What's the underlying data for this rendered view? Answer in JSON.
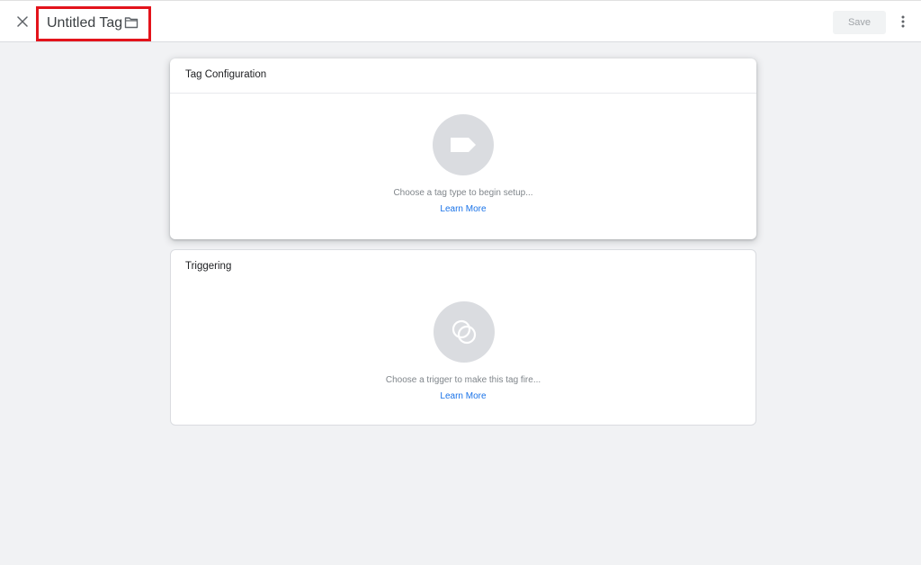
{
  "topbar": {
    "title": "Untitled Tag",
    "close_icon": "close-icon",
    "folder_icon": "folder-icon",
    "save_label": "Save",
    "more_icon": "more-vert-icon"
  },
  "tag_configuration": {
    "heading": "Tag Configuration",
    "icon": "tag-icon",
    "hint": "Choose a tag type to begin setup...",
    "learn_more": "Learn More"
  },
  "triggering": {
    "heading": "Triggering",
    "icon": "trigger-icon",
    "hint": "Choose a trigger to make this tag fire...",
    "learn_more": "Learn More"
  },
  "colors": {
    "highlight_box": "#e3131b",
    "link": "#1a73e8",
    "placeholder_circle": "#dadce0",
    "background": "#f1f2f4"
  }
}
